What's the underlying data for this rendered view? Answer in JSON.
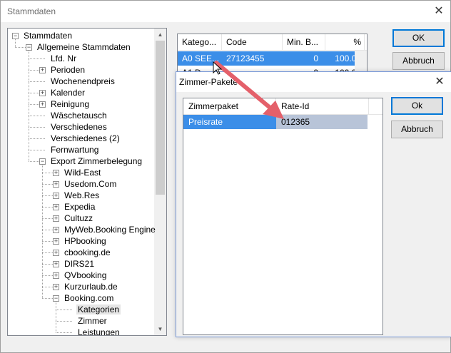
{
  "window": {
    "title": "Stammdaten",
    "close": "✕"
  },
  "tree": {
    "items": [
      {
        "label": "Stammdaten",
        "level": 0,
        "exp": "−"
      },
      {
        "label": "Allgemeine Stammdaten",
        "level": 1,
        "exp": "−"
      },
      {
        "label": "Lfd. Nr",
        "level": 2,
        "exp": ""
      },
      {
        "label": "Perioden",
        "level": 2,
        "exp": "+"
      },
      {
        "label": "Wochenendpreis",
        "level": 2,
        "exp": ""
      },
      {
        "label": "Kalender",
        "level": 2,
        "exp": "+"
      },
      {
        "label": "Reinigung",
        "level": 2,
        "exp": "+"
      },
      {
        "label": "Wäschetausch",
        "level": 2,
        "exp": ""
      },
      {
        "label": "Verschiedenes",
        "level": 2,
        "exp": ""
      },
      {
        "label": "Verschiedenes (2)",
        "level": 2,
        "exp": ""
      },
      {
        "label": "Fernwartung",
        "level": 2,
        "exp": ""
      },
      {
        "label": "Export Zimmerbelegung",
        "level": 2,
        "exp": "−"
      },
      {
        "label": "Wild-East",
        "level": 3,
        "exp": "+"
      },
      {
        "label": "Usedom.Com",
        "level": 3,
        "exp": "+"
      },
      {
        "label": "Web.Res",
        "level": 3,
        "exp": "+"
      },
      {
        "label": "Expedia",
        "level": 3,
        "exp": "+"
      },
      {
        "label": "Cultuzz",
        "level": 3,
        "exp": "+"
      },
      {
        "label": "MyWeb.Booking Engine",
        "level": 3,
        "exp": "+"
      },
      {
        "label": "HPbooking",
        "level": 3,
        "exp": "+"
      },
      {
        "label": "cbooking.de",
        "level": 3,
        "exp": "+"
      },
      {
        "label": "DIRS21",
        "level": 3,
        "exp": "+"
      },
      {
        "label": "QVbooking",
        "level": 3,
        "exp": "+"
      },
      {
        "label": "Kurzurlaub.de",
        "level": 3,
        "exp": "+"
      },
      {
        "label": "Booking.com",
        "level": 3,
        "exp": "−"
      },
      {
        "label": "Kategorien",
        "level": 4,
        "exp": "",
        "selected": true
      },
      {
        "label": "Zimmer",
        "level": 4,
        "exp": ""
      },
      {
        "label": "Leistungen",
        "level": 4,
        "exp": ""
      }
    ]
  },
  "list": {
    "columns": [
      "Katego...",
      "Code",
      "Min. B...",
      "%"
    ],
    "rows": [
      {
        "kat": "A0 SEE...",
        "code": "27123455",
        "minb": "0",
        "pct": "100.00",
        "selected": true
      },
      {
        "kat": "A1 D...",
        "code": "",
        "minb": "0",
        "pct": "100.00",
        "selected": false
      }
    ]
  },
  "buttons": {
    "ok": "OK",
    "abbruch": "Abbruch"
  },
  "dialog": {
    "title": "Zimmer-Pakete",
    "close": "✕",
    "columns": [
      "Zimmerpaket",
      "Rate-Id"
    ],
    "rows": [
      {
        "paket": "Preisrate",
        "rate": "012365"
      }
    ],
    "ok": "Ok",
    "abbruch": "Abbruch"
  },
  "colors": {
    "selection": "#3b8ee8",
    "selection_cell": "#b8c4d8",
    "arrow": "#e4606a"
  }
}
